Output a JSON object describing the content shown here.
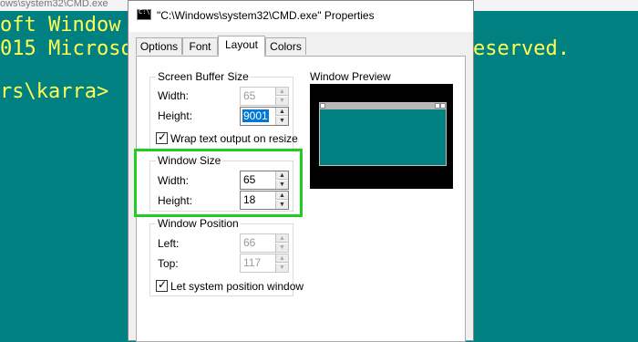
{
  "console": {
    "title": "ows\\system32\\CMD.exe",
    "line1": "oft Window",
    "line1_right": "",
    "line2_left": "015 Microso",
    "line2_right": "eserved.",
    "line3": "rs\\karra>"
  },
  "dialog": {
    "title": "\"C:\\Windows\\system32\\CMD.exe\" Properties",
    "tabs": [
      {
        "label": "Options"
      },
      {
        "label": "Font"
      },
      {
        "label": "Layout"
      },
      {
        "label": "Colors"
      }
    ],
    "active_tab": "Layout",
    "screen_buffer": {
      "legend": "Screen Buffer Size",
      "width_label": "Width:",
      "width_value": "65",
      "height_label": "Height:",
      "height_value": "9001",
      "wrap_label": "Wrap text output on resize",
      "wrap_checked": true
    },
    "window_size": {
      "legend": "Window Size",
      "width_label": "Width:",
      "width_value": "65",
      "height_label": "Height:",
      "height_value": "18"
    },
    "window_position": {
      "legend": "Window Position",
      "left_label": "Left:",
      "left_value": "66",
      "top_label": "Top:",
      "top_value": "117",
      "system_label": "Let system position window",
      "system_checked": true
    },
    "preview": {
      "label": "Window Preview"
    }
  },
  "colors": {
    "console_bg": "#008080",
    "console_text": "#ffff55",
    "highlight": "#22cc22",
    "selection": "#0078d7"
  }
}
